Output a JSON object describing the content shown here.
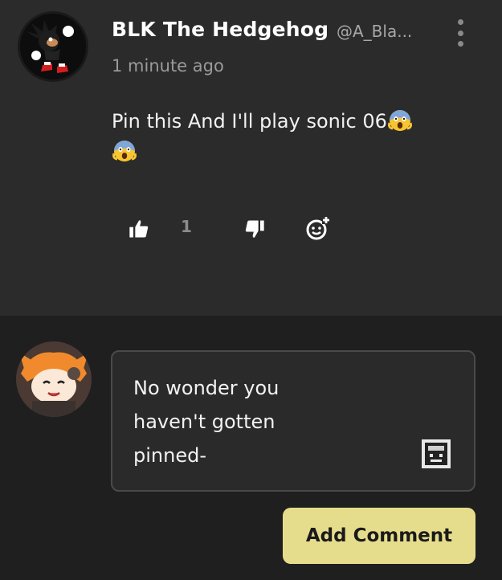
{
  "comment": {
    "author_name": "BLK The Hedgehog",
    "author_handle": "@A_Bla...",
    "timestamp": "1 minute ago",
    "body_line1": "Pin this And I'll play sonic 06",
    "like_count": "1",
    "avatar_icon": "dark-hedgehog-avatar",
    "emoji_icon": "screaming-face-emoji"
  },
  "composer": {
    "input_value": "No wonder you\nhaven't gotten\npinned-",
    "add_comment_label": "Add Comment",
    "avatar_icon": "fox-character-avatar",
    "sticker_icon": "sticker-icon"
  },
  "colors": {
    "background": "#2b2b2b",
    "composer_background": "#1f1f1f",
    "button_accent": "#e6dd8c",
    "muted_text": "#9a9a9a"
  }
}
